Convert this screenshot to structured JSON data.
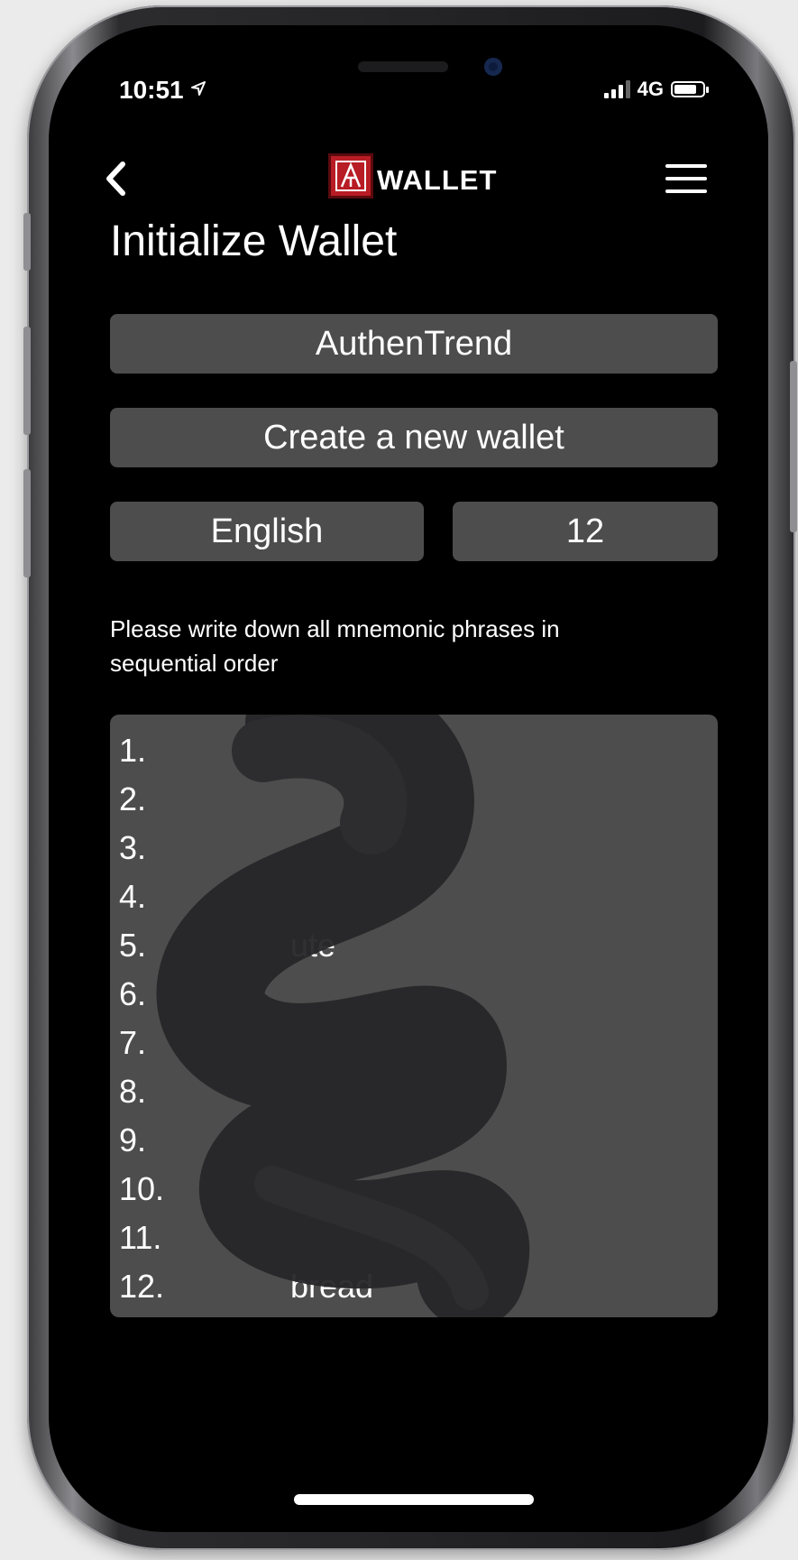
{
  "status_bar": {
    "time": "10:51",
    "network": "4G"
  },
  "nav": {
    "logo_text": "WALLET",
    "back_icon": "chevron-left-icon",
    "menu_icon": "hamburger-menu-icon",
    "logo_icon": "authentrend-logo-icon"
  },
  "page_title": "Initialize Wallet",
  "device_name": "AuthenTrend",
  "create_button": "Create a new wallet",
  "language_select": "English",
  "word_count_select": "12",
  "instructions": "Please write down all mnemonic phrases in sequential order",
  "mnemonic": {
    "rows": [
      {
        "num": "1.",
        "word": ""
      },
      {
        "num": "2.",
        "word": ""
      },
      {
        "num": "3.",
        "word": ""
      },
      {
        "num": "4.",
        "word": ""
      },
      {
        "num": "5.",
        "word": "ute"
      },
      {
        "num": "6.",
        "word": ""
      },
      {
        "num": "7.",
        "word": ""
      },
      {
        "num": "8.",
        "word": ""
      },
      {
        "num": "9.",
        "word": ""
      },
      {
        "num": "10.",
        "word": ""
      },
      {
        "num": "11.",
        "word": ""
      },
      {
        "num": "12.",
        "word": "bread"
      }
    ]
  },
  "colors": {
    "background": "#000000",
    "button": "#4d4d4d",
    "logo_red": "#b81c24",
    "text": "#ffffff"
  }
}
